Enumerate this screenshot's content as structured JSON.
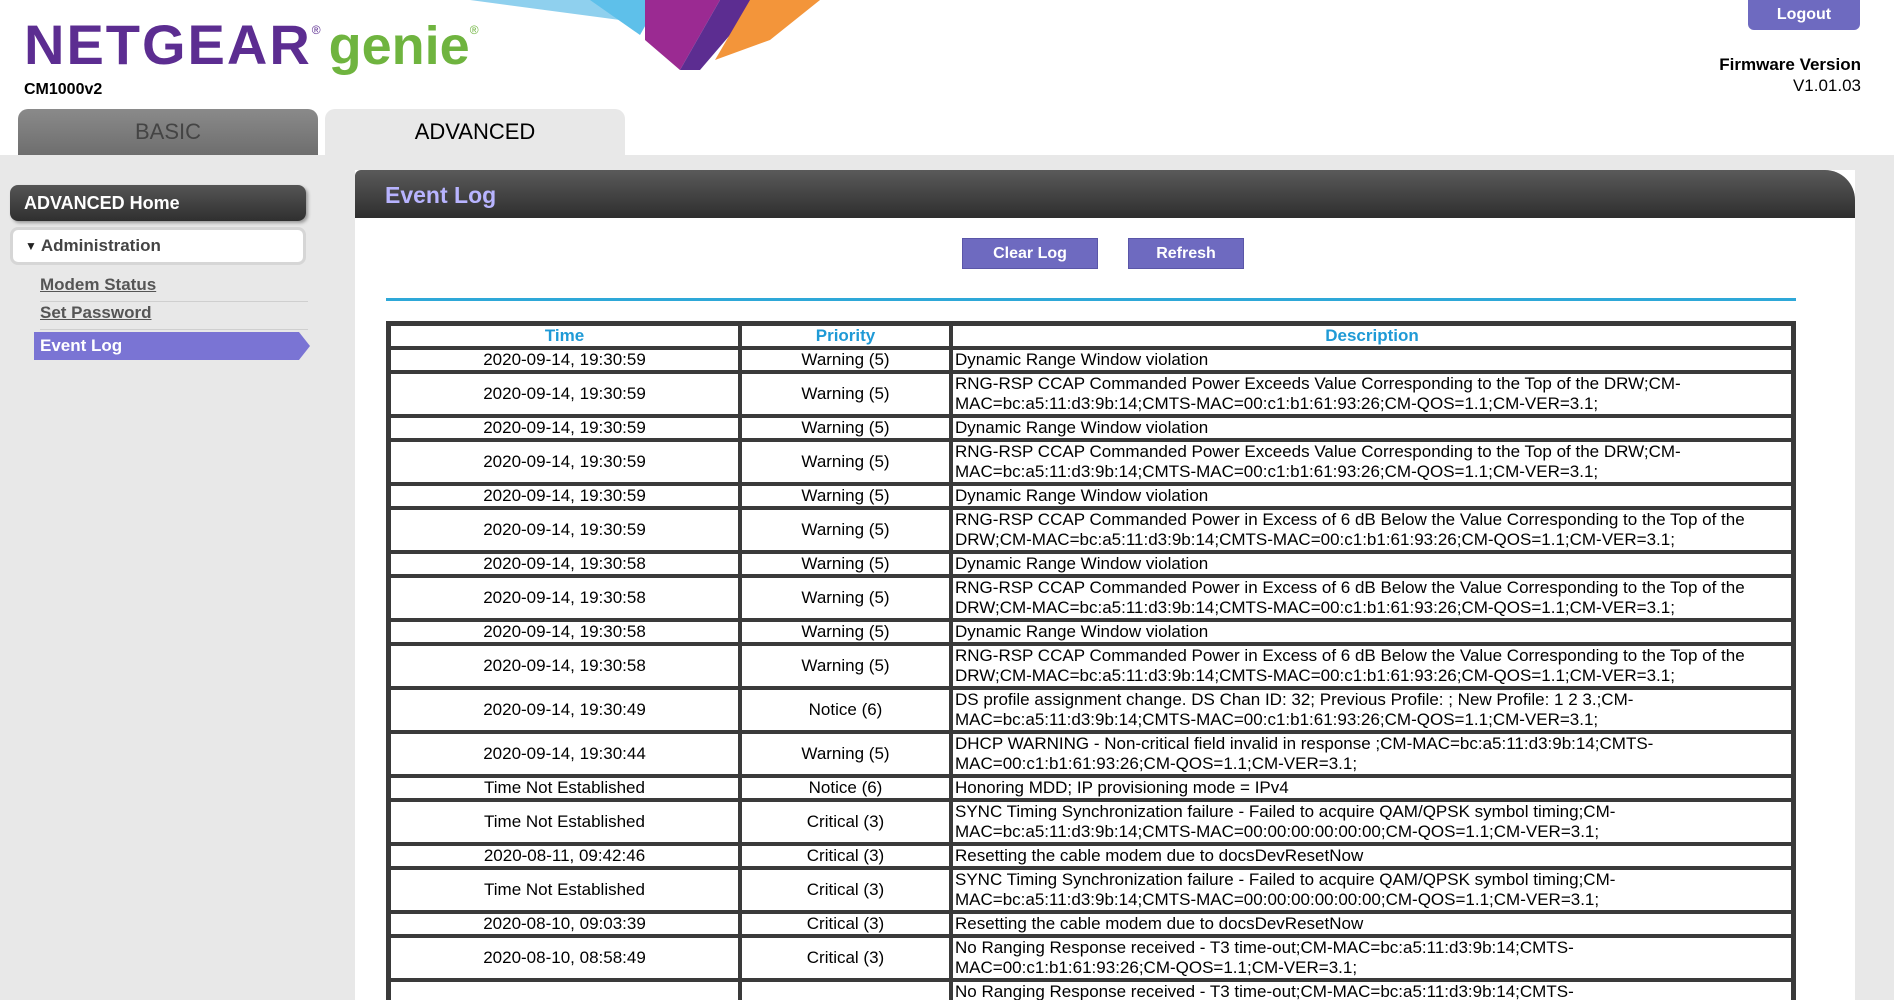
{
  "header": {
    "brand": "NETGEAR",
    "product": "genie",
    "model": "CM1000v2",
    "logout_label": "Logout",
    "firmware_label": "Firmware Version",
    "firmware_value": "V1.01.03",
    "tabs": [
      {
        "label": "BASIC",
        "active": false
      },
      {
        "label": "ADVANCED",
        "active": true
      }
    ]
  },
  "colors": {
    "brand_purple": "#5c2d91",
    "genie_green": "#6fb43f",
    "button_purple": "#6e6ac0",
    "header_blue": "#1f9ad6"
  },
  "sidebar": {
    "home_label": "ADVANCED Home",
    "section_label": "Administration",
    "items": [
      {
        "label": "Modem Status",
        "active": false
      },
      {
        "label": "Set Password",
        "active": false
      },
      {
        "label": "Event Log",
        "active": true
      }
    ]
  },
  "main": {
    "title": "Event Log",
    "clear_label": "Clear Log",
    "refresh_label": "Refresh",
    "columns": [
      "Time",
      "Priority",
      "Description"
    ],
    "rows": [
      {
        "time": "2020-09-14, 19:30:59",
        "priority": "Warning (5)",
        "desc": "Dynamic Range Window violation"
      },
      {
        "time": "2020-09-14, 19:30:59",
        "priority": "Warning (5)",
        "desc": "RNG-RSP CCAP Commanded Power Exceeds Value Corresponding to the Top of the DRW;CM-MAC=bc:a5:11:d3:9b:14;CMTS-MAC=00:c1:b1:61:93:26;CM-QOS=1.1;CM-VER=3.1;"
      },
      {
        "time": "2020-09-14, 19:30:59",
        "priority": "Warning (5)",
        "desc": "Dynamic Range Window violation"
      },
      {
        "time": "2020-09-14, 19:30:59",
        "priority": "Warning (5)",
        "desc": "RNG-RSP CCAP Commanded Power Exceeds Value Corresponding to the Top of the DRW;CM-MAC=bc:a5:11:d3:9b:14;CMTS-MAC=00:c1:b1:61:93:26;CM-QOS=1.1;CM-VER=3.1;"
      },
      {
        "time": "2020-09-14, 19:30:59",
        "priority": "Warning (5)",
        "desc": "Dynamic Range Window violation"
      },
      {
        "time": "2020-09-14, 19:30:59",
        "priority": "Warning (5)",
        "desc": "RNG-RSP CCAP Commanded Power in Excess of 6 dB Below the Value Corresponding to the Top of the DRW;CM-MAC=bc:a5:11:d3:9b:14;CMTS-MAC=00:c1:b1:61:93:26;CM-QOS=1.1;CM-VER=3.1;"
      },
      {
        "time": "2020-09-14, 19:30:58",
        "priority": "Warning (5)",
        "desc": "Dynamic Range Window violation"
      },
      {
        "time": "2020-09-14, 19:30:58",
        "priority": "Warning (5)",
        "desc": "RNG-RSP CCAP Commanded Power in Excess of 6 dB Below the Value Corresponding to the Top of the DRW;CM-MAC=bc:a5:11:d3:9b:14;CMTS-MAC=00:c1:b1:61:93:26;CM-QOS=1.1;CM-VER=3.1;"
      },
      {
        "time": "2020-09-14, 19:30:58",
        "priority": "Warning (5)",
        "desc": "Dynamic Range Window violation"
      },
      {
        "time": "2020-09-14, 19:30:58",
        "priority": "Warning (5)",
        "desc": "RNG-RSP CCAP Commanded Power in Excess of 6 dB Below the Value Corresponding to the Top of the DRW;CM-MAC=bc:a5:11:d3:9b:14;CMTS-MAC=00:c1:b1:61:93:26;CM-QOS=1.1;CM-VER=3.1;"
      },
      {
        "time": "2020-09-14, 19:30:49",
        "priority": "Notice (6)",
        "desc": "DS profile assignment change. DS Chan ID: 32; Previous Profile: ; New Profile: 1 2 3.;CM-MAC=bc:a5:11:d3:9b:14;CMTS-MAC=00:c1:b1:61:93:26;CM-QOS=1.1;CM-VER=3.1;"
      },
      {
        "time": "2020-09-14, 19:30:44",
        "priority": "Warning (5)",
        "desc": "DHCP WARNING - Non-critical field invalid in response ;CM-MAC=bc:a5:11:d3:9b:14;CMTS-MAC=00:c1:b1:61:93:26;CM-QOS=1.1;CM-VER=3.1;"
      },
      {
        "time": "Time Not Established",
        "priority": "Notice (6)",
        "desc": "Honoring MDD; IP provisioning mode = IPv4"
      },
      {
        "time": "Time Not Established",
        "priority": "Critical (3)",
        "desc": "SYNC Timing Synchronization failure - Failed to acquire QAM/QPSK symbol timing;CM-MAC=bc:a5:11:d3:9b:14;CMTS-MAC=00:00:00:00:00:00;CM-QOS=1.1;CM-VER=3.1;"
      },
      {
        "time": "2020-08-11, 09:42:46",
        "priority": "Critical (3)",
        "desc": "Resetting the cable modem due to docsDevResetNow"
      },
      {
        "time": "Time Not Established",
        "priority": "Critical (3)",
        "desc": "SYNC Timing Synchronization failure - Failed to acquire QAM/QPSK symbol timing;CM-MAC=bc:a5:11:d3:9b:14;CMTS-MAC=00:00:00:00:00:00;CM-QOS=1.1;CM-VER=3.1;"
      },
      {
        "time": "2020-08-10, 09:03:39",
        "priority": "Critical (3)",
        "desc": "Resetting the cable modem due to docsDevResetNow"
      },
      {
        "time": "2020-08-10, 08:58:49",
        "priority": "Critical (3)",
        "desc": "No Ranging Response received - T3 time-out;CM-MAC=bc:a5:11:d3:9b:14;CMTS-MAC=00:c1:b1:61:93:26;CM-QOS=1.1;CM-VER=3.1;"
      },
      {
        "time": "",
        "priority": "",
        "desc": "No Ranging Response received - T3 time-out;CM-MAC=bc:a5:11:d3:9b:14;CMTS-"
      }
    ]
  }
}
